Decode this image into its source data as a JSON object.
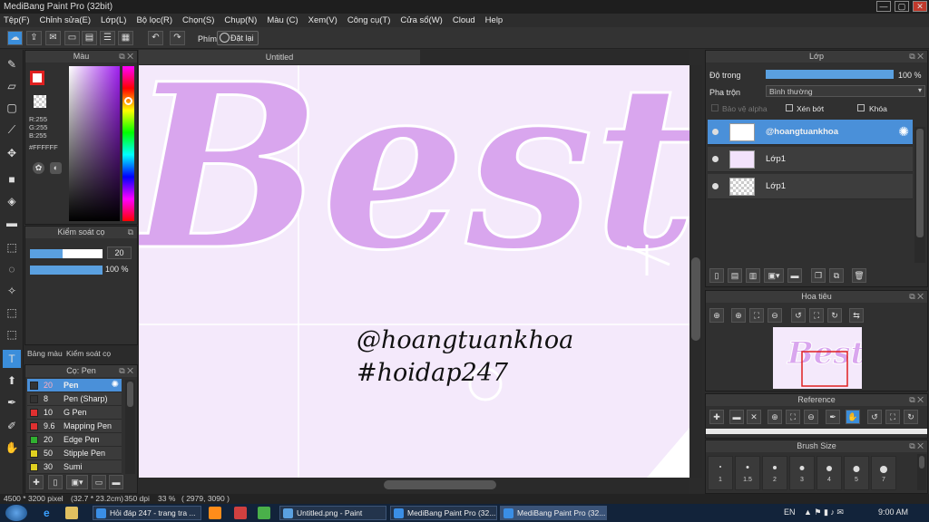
{
  "window": {
    "title": "MediBang Paint Pro (32bit)",
    "min": "—",
    "max": "▢",
    "close": "✕"
  },
  "menu": [
    "Tệp(F)",
    "Chỉnh sửa(E)",
    "Lớp(L)",
    "Bộ lọc(R)",
    "Chọn(S)",
    "Chụp(N)",
    "Màu (C)",
    "Xem(V)",
    "Công cụ(T)",
    "Cửa sổ(W)",
    "Cloud",
    "Help"
  ],
  "toolbar": {
    "shortcut_label": "Phím",
    "reset_label": "Đặt lại"
  },
  "color_panel": {
    "title": "Màu",
    "r": "R:255",
    "g": "G:255",
    "b": "B:255",
    "hex": "#FFFFFF"
  },
  "brush_control": {
    "title": "Kiểm soát cọ",
    "size_value": "20",
    "size_fill": 0.45,
    "opacity_value": "100 %",
    "opacity_fill": 1.0
  },
  "tabs": {
    "palette": "Bảng màu",
    "brush_control": "Kiểm soát cọ"
  },
  "brush_panel": {
    "title": "Cọ: Pen",
    "items": [
      {
        "size": "20",
        "name": "Pen",
        "color": "#333333",
        "selected": true
      },
      {
        "size": "8",
        "name": "Pen (Sharp)",
        "color": "#333333"
      },
      {
        "size": "10",
        "name": "G Pen",
        "color": "#e03030"
      },
      {
        "size": "9.6",
        "name": "Mapping Pen",
        "color": "#e03030"
      },
      {
        "size": "20",
        "name": "Edge Pen",
        "color": "#30b030"
      },
      {
        "size": "50",
        "name": "Stipple Pen",
        "color": "#e0d020"
      },
      {
        "size": "30",
        "name": "Sumi",
        "color": "#e0d020"
      }
    ]
  },
  "canvas": {
    "tab_title": "Untitled",
    "bg_color": "#f4e9fb",
    "letter_color": "#d9a6ee",
    "artwork_text": "Best",
    "handle": "@hoangtuankhoa",
    "hashtag": "#hoidap247"
  },
  "layer_panel": {
    "title": "Lớp",
    "opacity_label": "Độ trong",
    "opacity_value": "100 %",
    "opacity_fill": 1.0,
    "blend_label": "Pha trộn",
    "blend_value": "Bình thường",
    "protect_alpha": "Bảo vệ alpha",
    "clipping": "Xén bớt",
    "lock": "Khóa",
    "layers": [
      {
        "name": "@hoangtuankhoa",
        "selected": true
      },
      {
        "name": "Lớp1"
      },
      {
        "name": "Lớp1"
      }
    ]
  },
  "navigator": {
    "title": "Hoa tiêu"
  },
  "reference": {
    "title": "Reference"
  },
  "brush_size_panel": {
    "title": "Brush Size",
    "sizes": [
      "1",
      "1.5",
      "2",
      "3",
      "4",
      "5",
      "7"
    ]
  },
  "status": {
    "size": "4500 * 3200 pixel",
    "cm": "(32.7 * 23.2cm)",
    "dpi": "350 dpi",
    "zoom": "33 %",
    "coords": "( 2979, 3090 )"
  },
  "taskbar": {
    "tasks": [
      "Hỏi đáp 247 - trang tra ...",
      "Untitled.png - Paint",
      "MediBang Paint Pro (32...",
      "MediBang Paint Pro (32..."
    ],
    "lang": "EN",
    "time": "9:00 AM"
  }
}
